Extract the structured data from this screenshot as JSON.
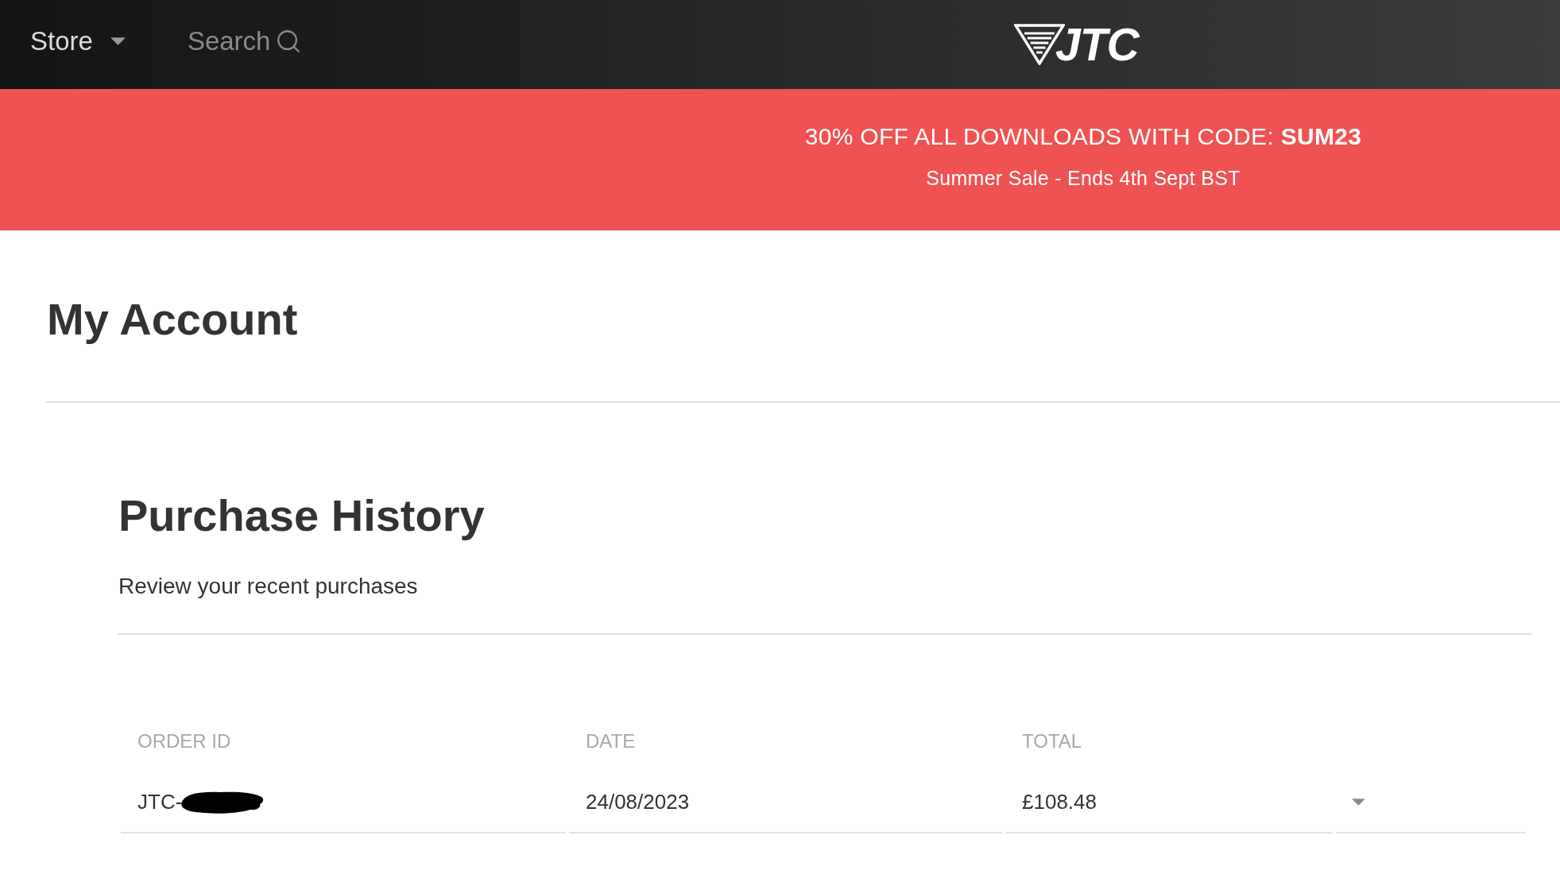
{
  "nav": {
    "menu": {
      "label": "Store"
    },
    "search": {
      "label": "Search"
    },
    "logo": {
      "text": "JTC"
    }
  },
  "promo_banner": {
    "headline": "30% OFF ALL DOWNLOADS WITH CODE: **SUM23**",
    "subline": "Summer Sale - Ends 4th Sept BST"
  },
  "page": {
    "title": "My Account"
  },
  "purchase_history": {
    "title": "Purchase History",
    "subtitle": "Review your recent purchases",
    "table": {
      "columns": [
        "ORDER ID",
        "DATE",
        "TOTAL"
      ],
      "rows": [
        {
          "order_id": "JTC-",
          "order_id_redacted": true,
          "date": "24/08/2023",
          "total": "£108.48",
          "expanded": false
        }
      ]
    }
  }
}
